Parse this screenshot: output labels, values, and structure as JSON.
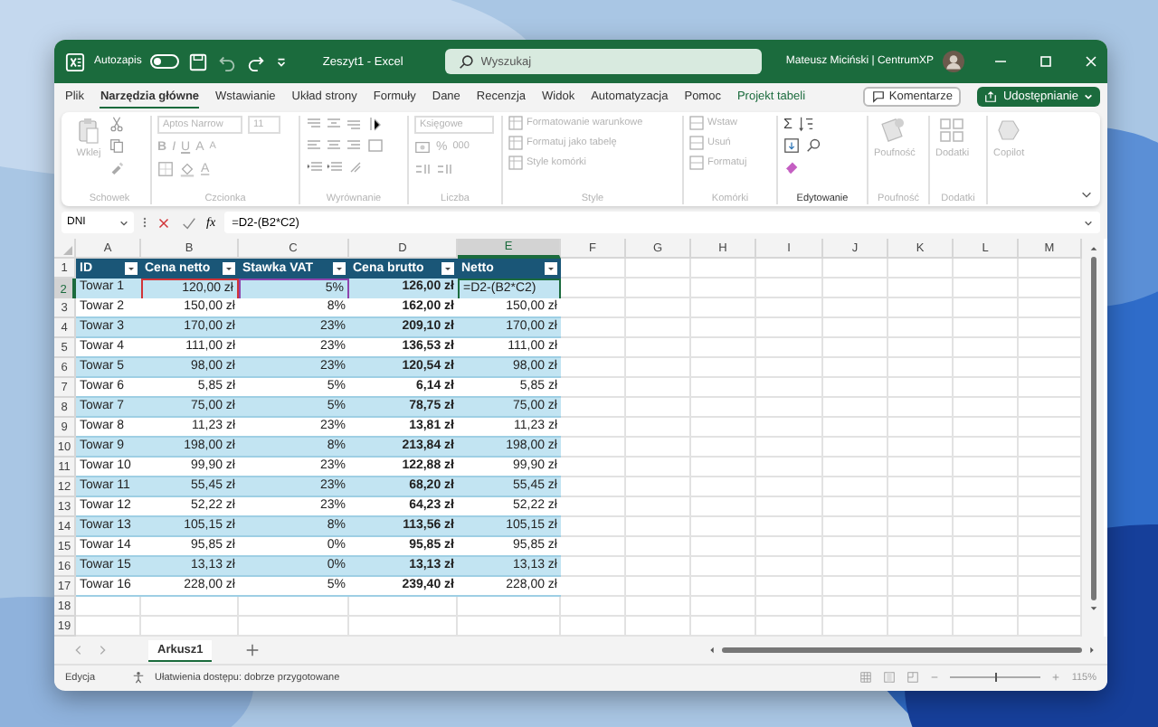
{
  "title_bar": {
    "autosave_label": "Autozapis",
    "autosave_on": false,
    "file_title": "Zeszyt1 - Excel",
    "search_placeholder": "Wyszukaj",
    "user": "Mateusz Miciński | CentrumXP"
  },
  "menu_tabs": [
    {
      "label": "Plik",
      "selected": false,
      "contextual": false
    },
    {
      "label": "Narzędzia główne",
      "selected": true,
      "contextual": false
    },
    {
      "label": "Wstawianie",
      "selected": false,
      "contextual": false
    },
    {
      "label": "Układ strony",
      "selected": false,
      "contextual": false
    },
    {
      "label": "Formuły",
      "selected": false,
      "contextual": false
    },
    {
      "label": "Dane",
      "selected": false,
      "contextual": false
    },
    {
      "label": "Recenzja",
      "selected": false,
      "contextual": false
    },
    {
      "label": "Widok",
      "selected": false,
      "contextual": false
    },
    {
      "label": "Automatyzacja",
      "selected": false,
      "contextual": false
    },
    {
      "label": "Pomoc",
      "selected": false,
      "contextual": false
    },
    {
      "label": "Projekt tabeli",
      "selected": false,
      "contextual": true
    }
  ],
  "comments_button": "Komentarze",
  "share_button": "Udostępnianie",
  "ribbon": {
    "clipboard": {
      "label": "Schowek",
      "paste": "Wklej",
      "disabled": true
    },
    "font": {
      "label": "Czcionka",
      "font_name": "Aptos Narrow",
      "font_size": "11",
      "bold": "B",
      "italic": "I",
      "underline": "U",
      "grow": "A",
      "shrink": "A",
      "font_color": "A",
      "disabled": true
    },
    "alignment": {
      "label": "Wyrównanie",
      "disabled": true
    },
    "number": {
      "label": "Liczba",
      "format": "Księgowe",
      "percent": "%",
      "thousands": "000",
      "disabled": true
    },
    "styles": {
      "label": "Style",
      "items": [
        "Formatowanie warunkowe",
        "Formatuj jako tabelę",
        "Style komórki"
      ],
      "disabled": true
    },
    "cells": {
      "label": "Komórki",
      "items": [
        "Wstaw",
        "Usuń",
        "Formatuj"
      ],
      "disabled": true
    },
    "editing": {
      "label": "Edytowanie",
      "sum": "Σ",
      "disabled": false
    },
    "sensitivity": {
      "label": "Poufność",
      "button": "Poufność",
      "disabled": true
    },
    "addins": {
      "label": "Dodatki",
      "button": "Dodatki",
      "disabled": true
    },
    "copilot": {
      "button": "Copilot",
      "disabled": true
    }
  },
  "formula_bar": {
    "name_box": "DNI",
    "fx": "fx",
    "formula": "=D2-(B2*C2)"
  },
  "grid": {
    "columns": [
      {
        "label": "A",
        "selected": false
      },
      {
        "label": "B",
        "selected": false
      },
      {
        "label": "C",
        "selected": false
      },
      {
        "label": "D",
        "selected": false
      },
      {
        "label": "E",
        "selected": true
      },
      {
        "label": "F",
        "selected": false
      },
      {
        "label": "G",
        "selected": false
      },
      {
        "label": "H",
        "selected": false
      },
      {
        "label": "I",
        "selected": false
      },
      {
        "label": "J",
        "selected": false
      },
      {
        "label": "K",
        "selected": false
      },
      {
        "label": "L",
        "selected": false
      },
      {
        "label": "M",
        "selected": false
      }
    ],
    "row_numbers": [
      {
        "label": "1",
        "selected": false
      },
      {
        "label": "2",
        "selected": true
      },
      {
        "label": "3",
        "selected": false
      },
      {
        "label": "4",
        "selected": false
      },
      {
        "label": "5",
        "selected": false
      },
      {
        "label": "6",
        "selected": false
      },
      {
        "label": "7",
        "selected": false
      },
      {
        "label": "8",
        "selected": false
      },
      {
        "label": "9",
        "selected": false
      },
      {
        "label": "10",
        "selected": false
      },
      {
        "label": "11",
        "selected": false
      },
      {
        "label": "12",
        "selected": false
      },
      {
        "label": "13",
        "selected": false
      },
      {
        "label": "14",
        "selected": false
      },
      {
        "label": "15",
        "selected": false
      },
      {
        "label": "16",
        "selected": false
      },
      {
        "label": "17",
        "selected": false
      },
      {
        "label": "18",
        "selected": false
      },
      {
        "label": "19",
        "selected": false
      }
    ]
  },
  "table": {
    "columns": [
      "ID",
      "Cena netto",
      "Stawka VAT",
      "Cena brutto",
      "Netto"
    ],
    "rows": [
      {
        "cells": [
          {
            "text": "Towar 1"
          },
          {
            "text": "120,00 zł",
            "color": "#d13438"
          },
          {
            "text": "5%",
            "color": "#8e44ad"
          },
          {
            "text": "126,00 zł"
          },
          {
            "text": "=D2-(B2*C2)",
            "editing": true
          }
        ]
      },
      {
        "cells": [
          "Towar 2",
          "150,00 zł",
          "8%",
          "162,00 zł",
          "150,00 zł"
        ]
      },
      {
        "cells": [
          "Towar 3",
          "170,00 zł",
          "23%",
          "209,10 zł",
          "170,00 zł"
        ]
      },
      {
        "cells": [
          "Towar 4",
          "111,00 zł",
          "23%",
          "136,53 zł",
          "111,00 zł"
        ]
      },
      {
        "cells": [
          "Towar 5",
          "98,00 zł",
          "23%",
          "120,54 zł",
          "98,00 zł"
        ]
      },
      {
        "cells": [
          "Towar 6",
          "5,85 zł",
          "5%",
          "6,14 zł",
          "5,85 zł"
        ]
      },
      {
        "cells": [
          "Towar 7",
          "75,00 zł",
          "5%",
          "78,75 zł",
          "75,00 zł"
        ]
      },
      {
        "cells": [
          "Towar 8",
          "11,23 zł",
          "23%",
          "13,81 zł",
          "11,23 zł"
        ]
      },
      {
        "cells": [
          "Towar 9",
          "198,00 zł",
          "8%",
          "213,84 zł",
          "198,00 zł"
        ]
      },
      {
        "cells": [
          "Towar 10",
          "99,90 zł",
          "23%",
          "122,88 zł",
          "99,90 zł"
        ]
      },
      {
        "cells": [
          "Towar 11",
          "55,45 zł",
          "23%",
          "68,20 zł",
          "55,45 zł"
        ]
      },
      {
        "cells": [
          "Towar 12",
          "52,22 zł",
          "23%",
          "64,23 zł",
          "52,22 zł"
        ]
      },
      {
        "cells": [
          "Towar 13",
          "105,15 zł",
          "8%",
          "113,56 zł",
          "105,15 zł"
        ]
      },
      {
        "cells": [
          "Towar 14",
          "95,85 zł",
          "0%",
          "95,85 zł",
          "95,85 zł"
        ]
      },
      {
        "cells": [
          "Towar 15",
          "13,13 zł",
          "0%",
          "13,13 zł",
          "13,13 zł"
        ]
      },
      {
        "cells": [
          "Towar 16",
          "228,00 zł",
          "5%",
          "239,40 zł",
          "228,00 zł"
        ]
      }
    ]
  },
  "sheet_tabs": [
    {
      "label": "Arkusz1",
      "selected": true
    }
  ],
  "status_bar": {
    "mode": "Edycja",
    "accessibility": "Ułatwienia dostępu: dobrze przygotowane",
    "zoom": {
      "level": 0.5,
      "reading": "115%"
    }
  }
}
